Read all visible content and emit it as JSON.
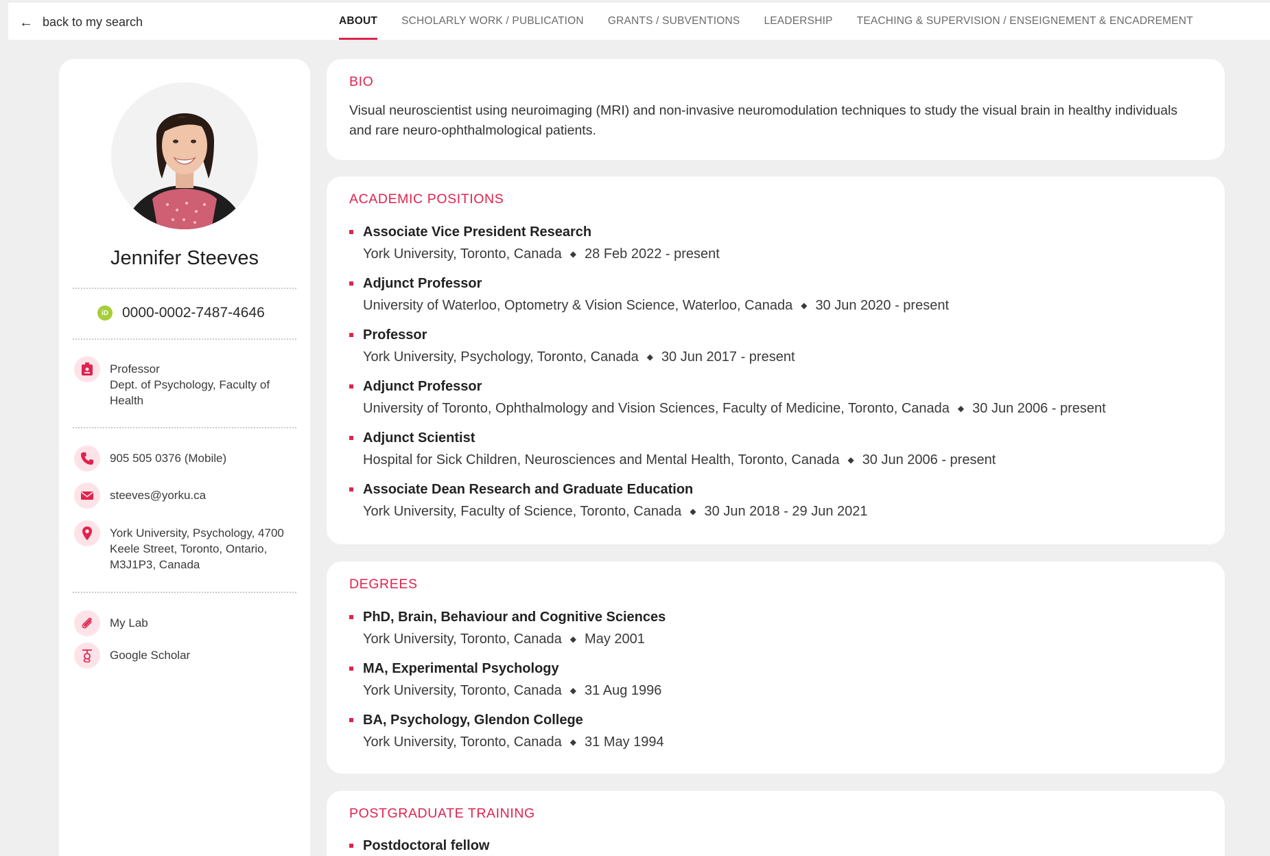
{
  "nav": {
    "back_label": "back to my search",
    "tabs": [
      {
        "label": "About",
        "active": true
      },
      {
        "label": "Scholarly Work / Publication",
        "active": false
      },
      {
        "label": "Grants / Subventions",
        "active": false
      },
      {
        "label": "Leadership",
        "active": false
      },
      {
        "label": "Teaching & Supervision / Enseignement & Encadrement",
        "active": false
      }
    ]
  },
  "profile": {
    "name": "Jennifer Steeves",
    "orcid_badge": "iD",
    "orcid": "0000-0002-7487-4646",
    "title": "Professor",
    "department": "Dept. of Psychology, Faculty of Health",
    "phone": "905 505 0376 (Mobile)",
    "email": "steeves@yorku.ca",
    "address": "York University, Psychology, 4700 Keele Street, Toronto, Ontario, M3J1P3, Canada",
    "links": [
      {
        "label": "My Lab",
        "icon": "paperclip-icon"
      },
      {
        "label": "Google Scholar",
        "icon": "google-scholar-icon"
      }
    ]
  },
  "bio": {
    "title": "Bio",
    "text": "Visual neuroscientist using neuroimaging (MRI) and non-invasive neuromodulation techniques to study the visual brain in healthy individuals and rare neuro-ophthalmological patients."
  },
  "positions": {
    "title": "Academic Positions",
    "items": [
      {
        "title": "Associate Vice President Research",
        "org": "York University, Toronto, Canada",
        "dates": "28 Feb 2022 - present"
      },
      {
        "title": "Adjunct Professor",
        "org": "University of Waterloo, Optometry & Vision Science, Waterloo, Canada",
        "dates": "30 Jun 2020 - present"
      },
      {
        "title": "Professor",
        "org": "York University, Psychology, Toronto, Canada",
        "dates": "30 Jun 2017 - present"
      },
      {
        "title": "Adjunct Professor",
        "org": "University of Toronto, Ophthalmology and Vision Sciences, Faculty of Medicine, Toronto, Canada",
        "dates": "30 Jun 2006 - present"
      },
      {
        "title": "Adjunct Scientist",
        "org": "Hospital for Sick Children, Neurosciences and Mental Health, Toronto, Canada",
        "dates": "30 Jun 2006 - present"
      },
      {
        "title": "Associate Dean Research and Graduate Education",
        "org": "York University, Faculty of Science, Toronto, Canada",
        "dates": "30 Jun 2018 - 29 Jun 2021"
      }
    ]
  },
  "degrees": {
    "title": "Degrees",
    "items": [
      {
        "title": "PhD, Brain, Behaviour and Cognitive Sciences",
        "org": "York University, Toronto, Canada",
        "dates": "May 2001"
      },
      {
        "title": "MA, Experimental Psychology",
        "org": "York University, Toronto, Canada",
        "dates": "31 Aug 1996"
      },
      {
        "title": "BA, Psychology, Glendon College",
        "org": "York University, Toronto, Canada",
        "dates": "31 May 1994"
      }
    ]
  },
  "training": {
    "title": "Postgraduate Training",
    "items": [
      {
        "title": "Postdoctoral fellow"
      }
    ]
  },
  "colors": {
    "accent": "#e0234e",
    "icon_bg": "#fde3e8",
    "orcid": "#a6ce39",
    "page_bg": "#efefef"
  }
}
